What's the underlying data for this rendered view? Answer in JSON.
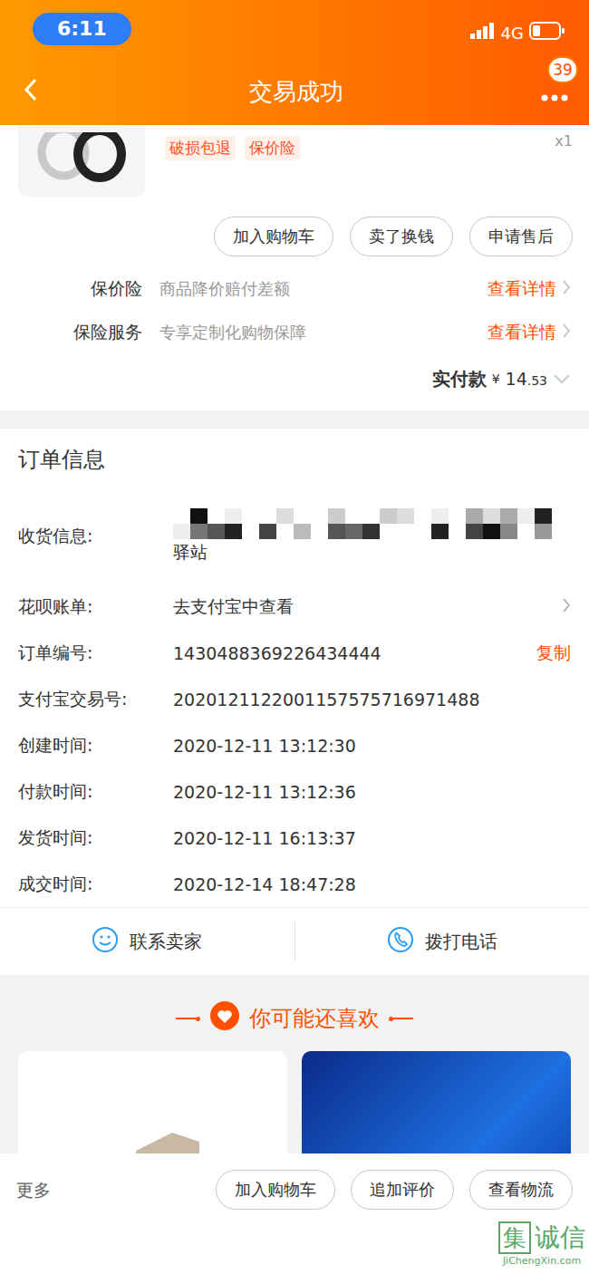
{
  "status_bar": {
    "time": "6:11",
    "network": "4G"
  },
  "header": {
    "title": "交易成功",
    "badge": "39"
  },
  "product": {
    "tags": [
      "破损包退",
      "保价险"
    ],
    "quantity": "x1",
    "buttons": [
      "加入购物车",
      "卖了换钱",
      "申请售后"
    ]
  },
  "services": [
    {
      "label": "保价险",
      "desc": "商品降价赔付差额",
      "link": "查看详情"
    },
    {
      "label": "保险服务",
      "desc": "专享定制化购物保障",
      "link": "查看详情"
    }
  ],
  "payment": {
    "label": "实付款",
    "currency": "¥",
    "integer": "14",
    "decimal": ".53"
  },
  "order_info": {
    "title": "订单信息",
    "address": {
      "label": "收货信息:",
      "tail": "驿站"
    },
    "rows": [
      {
        "label": "花呗账单:",
        "value": "去支付宝中查看",
        "kind": "link"
      },
      {
        "label": "订单编号:",
        "value": "1430488369226434444",
        "kind": "copy",
        "action": "复制"
      },
      {
        "label": "支付宝交易号:",
        "value": "2020121122001157575716971488",
        "kind": "plain"
      },
      {
        "label": "创建时间:",
        "value": "2020-12-11 13:12:30",
        "kind": "plain"
      },
      {
        "label": "付款时间:",
        "value": "2020-12-11 13:12:36",
        "kind": "plain"
      },
      {
        "label": "发货时间:",
        "value": "2020-12-11 16:13:37",
        "kind": "plain"
      },
      {
        "label": "成交时间:",
        "value": "2020-12-14 18:47:28",
        "kind": "plain"
      }
    ]
  },
  "contact": [
    {
      "label": "联系卖家",
      "kind": "chat"
    },
    {
      "label": "拨打电话",
      "kind": "phone"
    }
  ],
  "recommend": {
    "title": "你可能还喜欢"
  },
  "bottom_bar": {
    "more": "更多",
    "buttons": [
      "加入购物车",
      "追加评价",
      "查看物流"
    ]
  },
  "watermark": {
    "mark": "集",
    "name": "诚信",
    "site": "JiChengXin.com"
  }
}
